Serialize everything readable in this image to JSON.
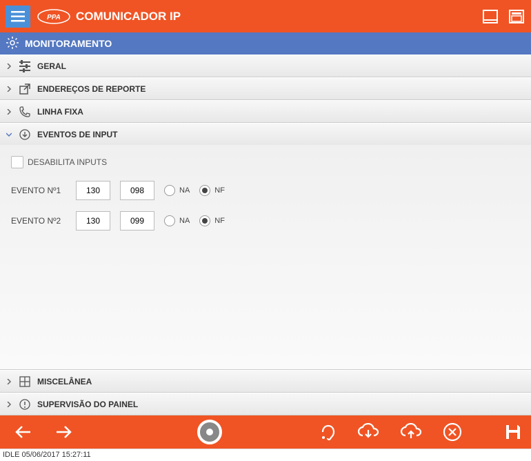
{
  "header": {
    "app_title": "COMUNICADOR IP"
  },
  "section": {
    "title": "MONITORAMENTO"
  },
  "panels": {
    "geral": {
      "title": "GERAL"
    },
    "enderecos": {
      "title": "ENDEREÇOS DE REPORTE"
    },
    "linha_fixa": {
      "title": "LINHA FIXA"
    },
    "eventos_input": {
      "title": "EVENTOS DE INPUT"
    },
    "miscelanea": {
      "title": "MISCELÂNEA"
    },
    "supervisao": {
      "title": "SUPERVISÃO DO PAINEL"
    }
  },
  "eventos_input": {
    "disable_label": "DESABILITA INPUTS",
    "events": [
      {
        "label": "EVENTO Nº1",
        "val1": "130",
        "val2": "098",
        "na": "NA",
        "nf": "NF",
        "selected": "nf"
      },
      {
        "label": "EVENTO Nº2",
        "val1": "130",
        "val2": "099",
        "na": "NA",
        "nf": "NF",
        "selected": "nf"
      }
    ]
  },
  "status_bar": {
    "text": "IDLE 05/06/2017 15:27:11"
  }
}
